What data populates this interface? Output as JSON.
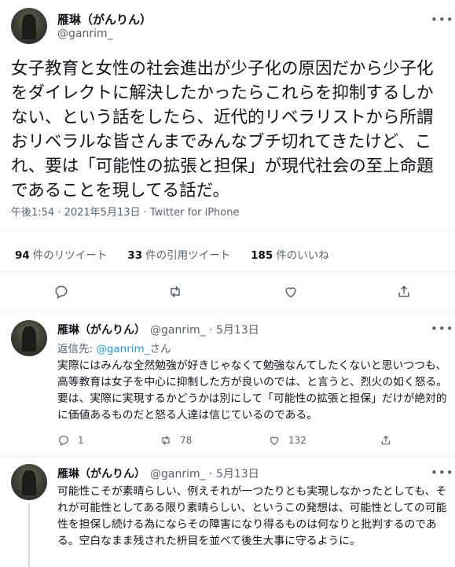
{
  "main_tweet": {
    "name": "雁琳（がんりん）",
    "handle": "@ganrim_",
    "text": "女子教育と女性の社会進出が少子化の原因だから少子化をダイレクトに解決したかったらこれらを抑制するしかない、という話をしたら、近代的リベラリストから所謂おリベラルな皆さんまでみんなブチ切れてきたけど、これ、要は「可能性の拡張と担保」が現代社会の至上命題であることを現してる話だ。",
    "time": "午後1:54 · 2021年5月13日 · Twitter for iPhone"
  },
  "stats": {
    "retweets_count": "94",
    "retweets_label": "件のリツイート",
    "quotes_count": "33",
    "quotes_label": "件の引用ツイート",
    "likes_count": "185",
    "likes_label": "件のいいね"
  },
  "replies": [
    {
      "name": "雁琳（がんりん）",
      "handle": "@ganrim_ · 5月13日",
      "reply_to_prefix": "返信先: ",
      "reply_to_mention": "@ganrim_",
      "reply_to_suffix": "さん",
      "text": "実際にはみんな全然勉強が好きじゃなくて勉強なんてしたくないと思いつつも、高等教育は女子を中心に抑制した方が良いのでは、と言うと、烈火の如く怒る。要は、実際に実現するかどうかは別にして「可能性の拡張と担保」だけが絶対的に価値あるものだと怒る人達は信じているのである。",
      "reply_count": "1",
      "retweet_count": "78",
      "like_count": "132"
    },
    {
      "name": "雁琳（がんりん）",
      "handle": "@ganrim_ · 5月13日",
      "text": "可能性こそが素晴らしい、例えそれが一つたりとも実現しなかったとしても、それが可能性としてある限り素晴らしい、というこの発想は、可能性としての可能性を担保し続ける為にならその障害になり得るものは何なりと批判するのである。空白なまま残された枡目を並べて後生大事に守るように。"
    }
  ]
}
